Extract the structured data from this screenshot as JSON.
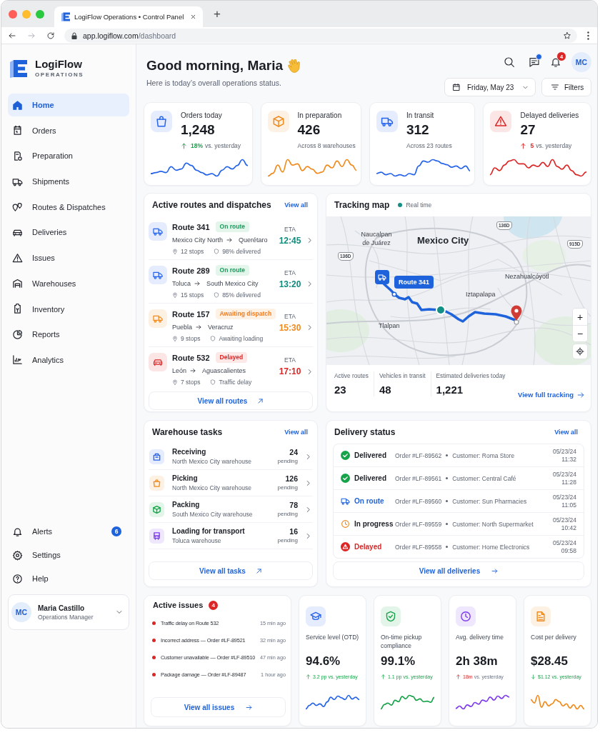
{
  "browser": {
    "tab_title": "LogiFlow Operations • Control Panel",
    "new_tab": "+",
    "url_host": "app.logiflow.com",
    "url_path": "/dashboard"
  },
  "sidebar": {
    "brand": "LogiFlow",
    "tagline": "OPERATIONS",
    "nav": [
      {
        "label": "Home",
        "selected": true
      },
      {
        "label": "Orders",
        "selected": false
      },
      {
        "label": "Preparation",
        "selected": false
      },
      {
        "label": "Shipments",
        "selected": false
      },
      {
        "label": "Routes & Dispatches",
        "selected": false
      },
      {
        "label": "Deliveries",
        "selected": false
      },
      {
        "label": "Issues",
        "selected": false
      },
      {
        "label": "Warehouses",
        "selected": false
      },
      {
        "label": "Inventory",
        "selected": false
      },
      {
        "label": "Reports",
        "selected": false
      },
      {
        "label": "Analytics",
        "selected": false
      }
    ],
    "footer_nav": [
      {
        "label": "Alerts",
        "badge": "6"
      },
      {
        "label": "Settings"
      },
      {
        "label": "Help"
      }
    ],
    "user": {
      "initials": "MC",
      "name": "Maria Castillo",
      "role": "Operations Manager"
    }
  },
  "header": {
    "greeting": "Good morning, Maria",
    "subtitle": "Here is today’s overall operations status.",
    "messages_unread": true,
    "notifications_badge": "4",
    "avatar_initials": "MC",
    "date": "Friday, May 23",
    "filters": "Filters"
  },
  "kpis": [
    {
      "label": "Orders today",
      "value": "1,248",
      "trend": {
        "up": true,
        "good": true,
        "change": "18%",
        "note": "vs. yesterday"
      },
      "color": "#2563eb"
    },
    {
      "label": "In preparation",
      "value": "426",
      "note": "Across 8 warehouses",
      "color": "#f08a1c"
    },
    {
      "label": "In transit",
      "value": "312",
      "note": "Across 23 routes",
      "color": "#2563eb"
    },
    {
      "label": "Delayed deliveries",
      "value": "27",
      "trend": {
        "up": true,
        "good": false,
        "change": "5",
        "note": "vs. yesterday"
      },
      "color": "#dc2626"
    }
  ],
  "routes": {
    "title": "Active routes and dispatches",
    "view_all": "View all",
    "items": [
      {
        "name": "Route 341",
        "status": "On route",
        "kind": "on_route",
        "from": "Mexico City North",
        "to": "Querétaro",
        "stops": "12 stops",
        "detail": "98% delivered",
        "eta_label": "ETA",
        "eta": "12:45"
      },
      {
        "name": "Route 289",
        "status": "On route",
        "kind": "on_route",
        "from": "Toluca",
        "to": "South Mexico City",
        "stops": "15 stops",
        "detail": "85% delivered",
        "eta_label": "ETA",
        "eta": "13:20"
      },
      {
        "name": "Route 157",
        "status": "Awaiting dispatch",
        "kind": "awaiting",
        "from": "Puebla",
        "to": "Veracruz",
        "stops": "9 stops",
        "detail": "Awaiting loading",
        "eta_label": "ETA",
        "eta": "15:30"
      },
      {
        "name": "Route 532",
        "status": "Delayed",
        "kind": "delayed",
        "from": "León",
        "to": "Aguascalientes",
        "stops": "7 stops",
        "detail": "Traffic delay",
        "eta_label": "ETA",
        "eta": "17:10"
      }
    ],
    "footer": "View all routes"
  },
  "map": {
    "title": "Tracking map",
    "live_label": "Real time",
    "places": [
      "Naucalpan de Juárez",
      "Mexico City",
      "Nezahualcóyotl",
      "Iztapalapa",
      "Tlalpan"
    ],
    "shields": [
      "136D",
      "136D",
      "915D"
    ],
    "vehicle_label": "Route 341",
    "zoom_in": "+",
    "zoom_out": "−",
    "stats": [
      {
        "label": "Active routes",
        "value": "23"
      },
      {
        "label": "Vehicles in transit",
        "value": "48"
      },
      {
        "label": "Estimated deliveries today",
        "value": "1,221"
      }
    ],
    "link": "View full tracking"
  },
  "warehouse": {
    "title": "Warehouse tasks",
    "view_all": "View all",
    "tasks": [
      {
        "name": "Receiving",
        "location": "North Mexico City warehouse",
        "count": "24",
        "unit": "pending"
      },
      {
        "name": "Picking",
        "location": "North Mexico City warehouse",
        "count": "126",
        "unit": "pending"
      },
      {
        "name": "Packing",
        "location": "South Mexico City warehouse",
        "count": "78",
        "unit": "pending"
      },
      {
        "name": "Loading for transport",
        "location": "Toluca warehouse",
        "count": "16",
        "unit": "pending"
      }
    ],
    "footer": "View all tasks"
  },
  "deliveries": {
    "title": "Delivery status",
    "view_all": "View all",
    "rows": [
      {
        "status": "Delivered",
        "kind": "delivered",
        "order": "Order #LF-89562",
        "customer": "Customer: Roma Store",
        "date": "05/23/24",
        "time": "11:32"
      },
      {
        "status": "Delivered",
        "kind": "delivered",
        "order": "Order #LF-89561",
        "customer": "Customer: Central Café",
        "date": "05/23/24",
        "time": "11:28"
      },
      {
        "status": "On route",
        "kind": "on_route",
        "order": "Order #LF-89560",
        "customer": "Customer: Sun Pharmacies",
        "date": "05/23/24",
        "time": "11:05"
      },
      {
        "status": "In progress",
        "kind": "in_progress",
        "order": "Order #LF-89559",
        "customer": "Customer: North Supermarket",
        "date": "05/23/24",
        "time": "10:42"
      },
      {
        "status": "Delayed",
        "kind": "delayed",
        "order": "Order #LF-89558",
        "customer": "Customer: Home Electronics",
        "date": "05/23/24",
        "time": "09:58"
      }
    ],
    "footer": "View all deliveries"
  },
  "issues": {
    "title": "Active issues",
    "count": "4",
    "items": [
      {
        "text": "Traffic delay on Route 532",
        "time": "15 min ago"
      },
      {
        "text": "Incorrect address — Order #LF-89521",
        "time": "32 min ago"
      },
      {
        "text": "Customer unavailable — Order #LF-89510",
        "time": "47 min ago"
      },
      {
        "text": "Package damage — Order #LF-89487",
        "time": "1 hour ago"
      }
    ],
    "footer": "View all issues"
  },
  "metrics": [
    {
      "label": "Service level (OTD)",
      "value": "94.6%",
      "trend": {
        "up": true,
        "good": true,
        "change": "3.2 pp",
        "note": "vs. yesterday"
      },
      "color": "#2563eb"
    },
    {
      "label": "On-time pickup compliance",
      "value": "99.1%",
      "trend": {
        "up": true,
        "good": true,
        "change": "1.1 pp",
        "note": "vs. yesterday"
      },
      "color": "#16a34a"
    },
    {
      "label": "Avg. delivery time",
      "value": "2h 38m",
      "trend": {
        "up": true,
        "good": false,
        "change": "18m",
        "note": "vs. yesterday"
      },
      "color": "#7c3aed"
    },
    {
      "label": "Cost per delivery",
      "value": "$28.45",
      "trend": {
        "up": false,
        "good": true,
        "change": "$1.12",
        "note": "vs. yesterday"
      },
      "color": "#f08a1c"
    }
  ]
}
